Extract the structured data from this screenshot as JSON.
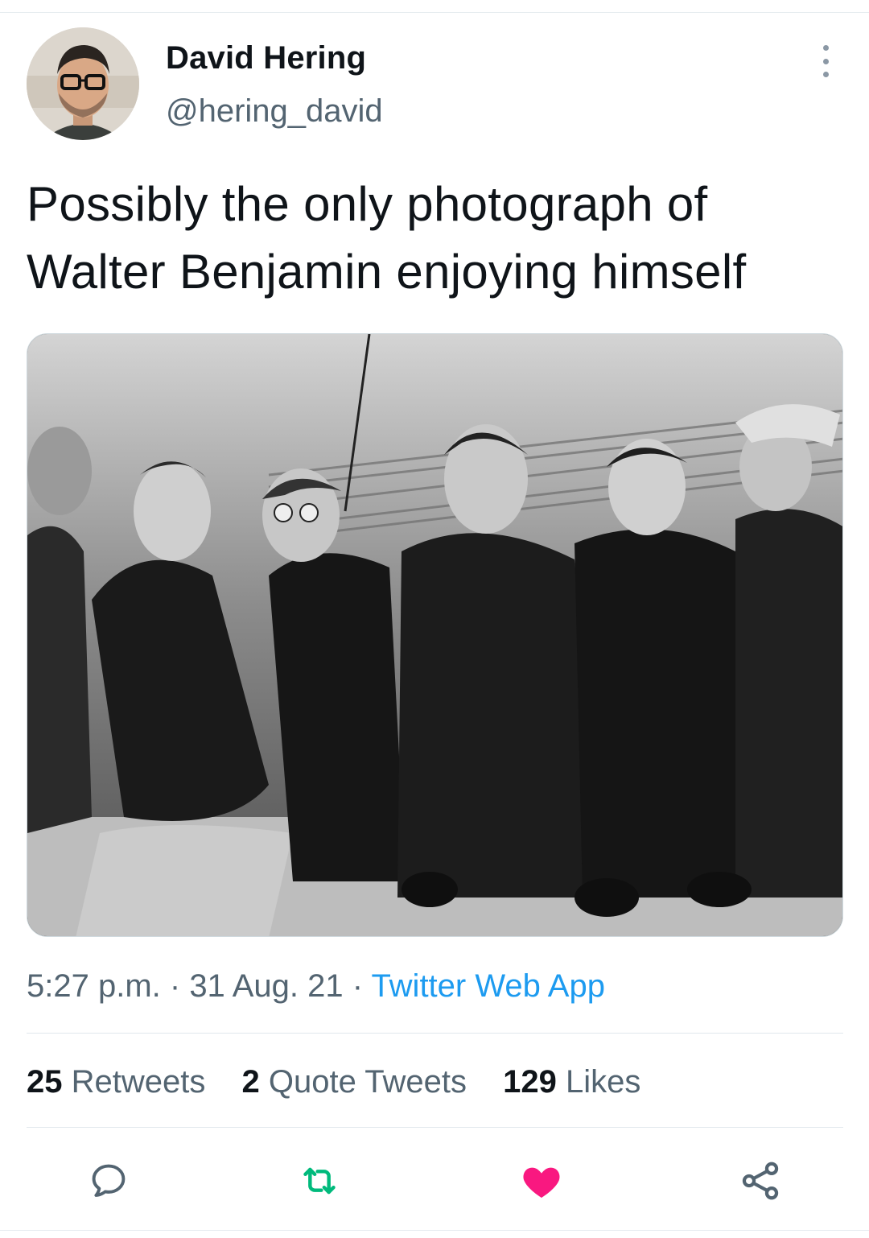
{
  "user": {
    "display_name": "David Hering",
    "handle": "@hering_david"
  },
  "tweet": {
    "text_line1": "Possibly the only photograph of",
    "text_line2": "Walter Benjamin enjoying himself"
  },
  "meta": {
    "time": "5:27 p.m.",
    "separator": " · ",
    "date": "31 Aug. 21",
    "source": "Twitter Web App"
  },
  "stats": {
    "retweets_count": "25",
    "retweets_label": "Retweets",
    "quotes_count": "2",
    "quotes_label": "Quote Tweets",
    "likes_count": "129",
    "likes_label": "Likes"
  },
  "actions": {
    "reply_icon": "reply-icon",
    "retweet_icon": "retweet-icon",
    "like_icon": "heart-icon",
    "share_icon": "share-icon"
  },
  "colors": {
    "link": "#1d9bf0",
    "retweet": "#00ba7c",
    "like": "#f91880",
    "muted": "#536471"
  }
}
